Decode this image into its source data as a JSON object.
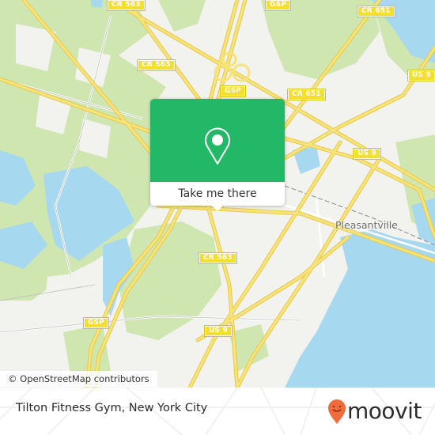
{
  "map": {
    "road_shields": [
      {
        "label": "CR 563",
        "name": "shield-cr563-north"
      },
      {
        "label": "GSP",
        "name": "shield-gsp-north"
      },
      {
        "label": "CR 651",
        "name": "shield-cr651-north"
      },
      {
        "label": "CR 563",
        "name": "shield-cr563-mid"
      },
      {
        "label": "US 9",
        "name": "shield-us9-northeast"
      },
      {
        "label": "GSP",
        "name": "shield-gsp-center"
      },
      {
        "label": "CR 651",
        "name": "shield-cr651-center"
      },
      {
        "label": "US 9",
        "name": "shield-us9-east"
      },
      {
        "label": "CR 563",
        "name": "shield-cr563-south"
      },
      {
        "label": "GSP",
        "name": "shield-gsp-south"
      },
      {
        "label": "US 9",
        "name": "shield-us9-south"
      }
    ],
    "place_labels": [
      {
        "label": "Pleasantville"
      }
    ],
    "attribution": "© OpenStreetMap contributors",
    "colors": {
      "land": "#f2f2ee",
      "park": "#cfe6b0",
      "water": "#a6d8ef",
      "road": "#f6e37a",
      "shield": "#f4df2c"
    }
  },
  "popup": {
    "pin_icon": "map-pin-icon",
    "cta_label": "Take me there",
    "color": "#22b868"
  },
  "footer": {
    "place_name": "Tilton Fitness Gym, New York City",
    "brand": "moovit",
    "brand_color": "#f26b3a"
  }
}
